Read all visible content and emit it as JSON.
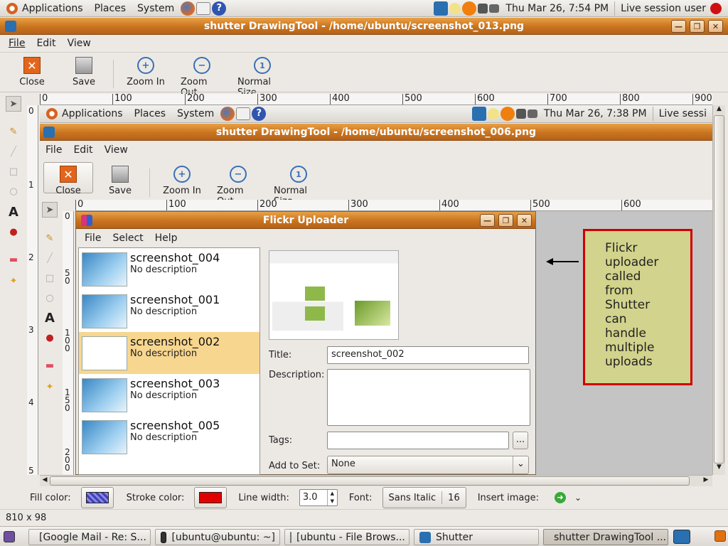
{
  "top_panel": {
    "applications": "Applications",
    "places": "Places",
    "system": "System",
    "clock": "Thu Mar 26,  7:54 PM",
    "user": "Live session user"
  },
  "window": {
    "title": "shutter DrawingTool - /home/ubuntu/screenshot_013.png",
    "menu": [
      "File",
      "Edit",
      "View"
    ],
    "toolbar": {
      "close": "Close",
      "save": "Save",
      "zoom_in": "Zoom In",
      "zoom_out": "Zoom Out",
      "normal_size": "Normal Size"
    },
    "ruler_ticks": [
      "0",
      "100",
      "200",
      "300",
      "400",
      "500",
      "600",
      "700",
      "800",
      "900"
    ],
    "vruler_ticks": [
      "0",
      "1",
      "2",
      "3",
      "4",
      "5"
    ]
  },
  "inner": {
    "panel": {
      "applications": "Applications",
      "places": "Places",
      "system": "System",
      "clock": "Thu Mar 26,  7:38 PM",
      "user": "Live sessi"
    },
    "title": "shutter DrawingTool - /home/ubuntu/screenshot_006.png",
    "menu": [
      "File",
      "Edit",
      "View"
    ],
    "toolbar": {
      "close": "Close",
      "save": "Save",
      "zoom_in": "Zoom In",
      "zoom_out": "Zoom Out",
      "normal_size": "Normal Size"
    },
    "ruler_ticks": [
      "0",
      "100",
      "200",
      "300",
      "400",
      "500",
      "600"
    ],
    "vruler_ticks": [
      "0",
      "5",
      "0",
      "1",
      "0",
      "0",
      "1",
      "5",
      "0",
      "2",
      "0",
      "0"
    ]
  },
  "flickr": {
    "title": "Flickr Uploader",
    "menu": [
      "File",
      "Select",
      "Help"
    ],
    "items": [
      {
        "name": "screenshot_004",
        "desc": "No description"
      },
      {
        "name": "screenshot_001",
        "desc": "No description"
      },
      {
        "name": "screenshot_002",
        "desc": "No description"
      },
      {
        "name": "screenshot_003",
        "desc": "No description"
      },
      {
        "name": "screenshot_005",
        "desc": "No description"
      }
    ],
    "title_label": "Title:",
    "title_value": "screenshot_002",
    "description_label": "Description:",
    "tags_label": "Tags:",
    "tags_button": "...",
    "set_label": "Add to Set:",
    "set_value": "None"
  },
  "annotation": {
    "text": "Flickr uploader called from Shutter can handle multiple uploads",
    "fill": "#d2d38c",
    "border": "#d00000"
  },
  "bottom_tools": {
    "fill_label": "Fill color:",
    "stroke_label": "Stroke color:",
    "line_width_label": "Line width:",
    "line_width_value": "3.0",
    "font_label": "Font:",
    "font_name": "Sans Italic",
    "font_size": "16",
    "insert_label": "Insert image:",
    "stroke_color": "#e00000",
    "fill_color": "#4040c0"
  },
  "status": "810 x 98",
  "taskbar": [
    "[Google Mail - Re: S...",
    "[ubuntu@ubuntu: ~]",
    "[ubuntu - File Brows...",
    "Shutter",
    "shutter DrawingTool ..."
  ]
}
